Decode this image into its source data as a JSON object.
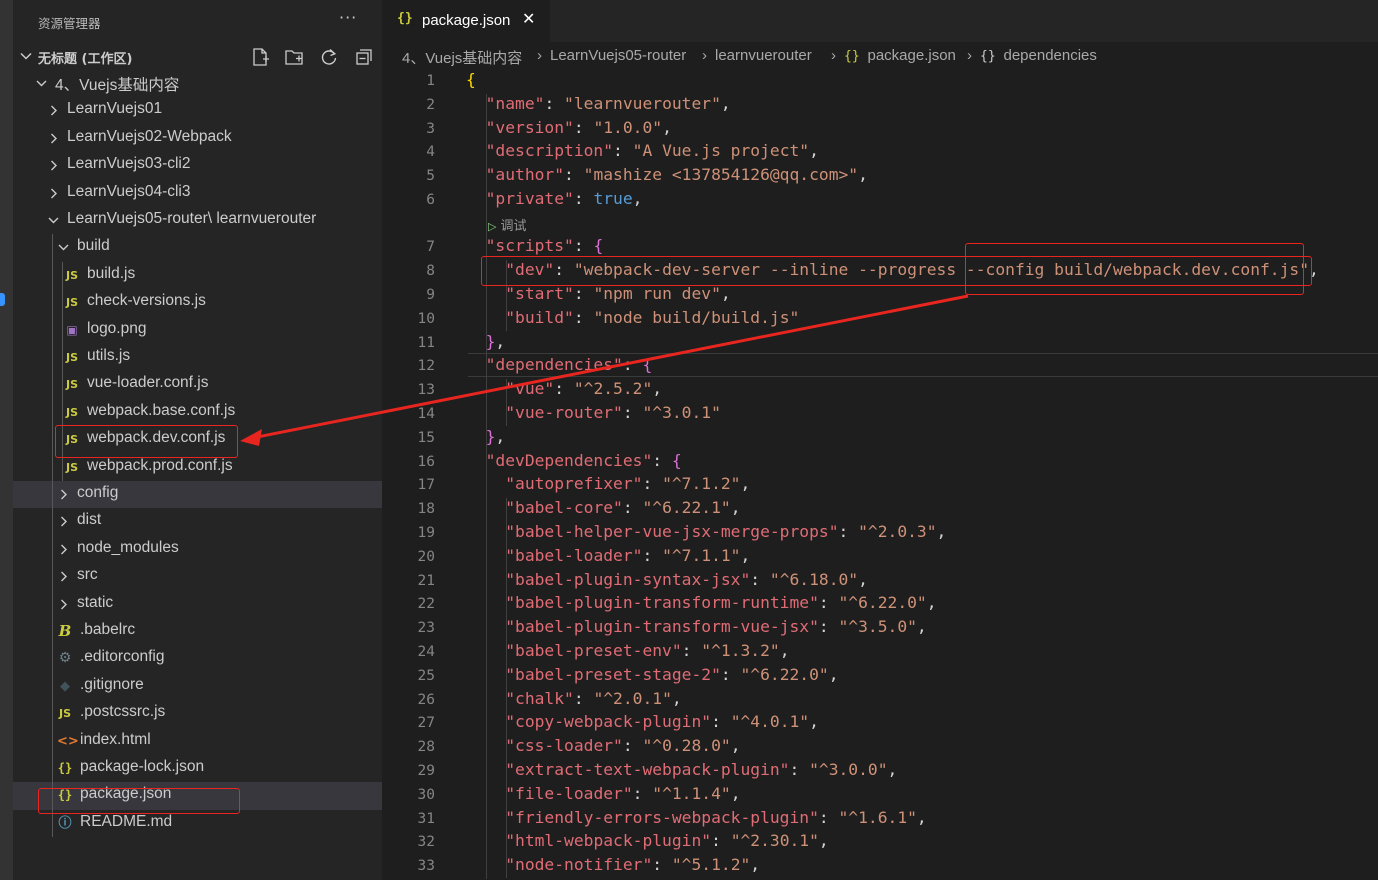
{
  "sidebar": {
    "title": "资源管理器",
    "more": "···",
    "workspace": "无标题 (工作区)",
    "actions": [
      "new-file-icon",
      "new-folder-icon",
      "refresh-icon",
      "collapse-all-icon"
    ],
    "tree": [
      {
        "label": "4、Vuejs基础内容",
        "type": "folder-open",
        "depth": 0
      },
      {
        "label": "LearnVuejs01",
        "type": "folder",
        "depth": 1
      },
      {
        "label": "LearnVuejs02-Webpack",
        "type": "folder",
        "depth": 1
      },
      {
        "label": "LearnVuejs03-cli2",
        "type": "folder",
        "depth": 1
      },
      {
        "label": "LearnVuejs04-cli3",
        "type": "folder",
        "depth": 1
      },
      {
        "label": "LearnVuejs05-router",
        "sub": "\\ learnvuerouter",
        "type": "folder-open",
        "depth": 1
      },
      {
        "label": "build",
        "type": "folder-open",
        "depth": 2
      },
      {
        "label": "build.js",
        "type": "js",
        "depth": 3
      },
      {
        "label": "check-versions.js",
        "type": "js",
        "depth": 3
      },
      {
        "label": "logo.png",
        "type": "png",
        "depth": 3
      },
      {
        "label": "utils.js",
        "type": "js",
        "depth": 3
      },
      {
        "label": "vue-loader.conf.js",
        "type": "js",
        "depth": 3
      },
      {
        "label": "webpack.base.conf.js",
        "type": "js",
        "depth": 3
      },
      {
        "label": "webpack.dev.conf.js",
        "type": "js",
        "depth": 3
      },
      {
        "label": "webpack.prod.conf.js",
        "type": "js",
        "depth": 3
      },
      {
        "label": "config",
        "type": "folder",
        "depth": 2,
        "selected": true
      },
      {
        "label": "dist",
        "type": "folder",
        "depth": 2
      },
      {
        "label": "node_modules",
        "type": "folder",
        "depth": 2
      },
      {
        "label": "src",
        "type": "folder",
        "depth": 2
      },
      {
        "label": "static",
        "type": "folder",
        "depth": 2
      },
      {
        "label": ".babelrc",
        "type": "babel",
        "depth": 2
      },
      {
        "label": ".editorconfig",
        "type": "gear",
        "depth": 2
      },
      {
        "label": ".gitignore",
        "type": "git",
        "depth": 2
      },
      {
        "label": ".postcssrc.js",
        "type": "js",
        "depth": 2
      },
      {
        "label": "index.html",
        "type": "html",
        "depth": 2
      },
      {
        "label": "package-lock.json",
        "type": "json",
        "depth": 2
      },
      {
        "label": "package.json",
        "type": "json",
        "depth": 2,
        "selected": true
      },
      {
        "label": "README.md",
        "type": "info",
        "depth": 2
      }
    ]
  },
  "editor": {
    "tab": {
      "icon": "{}",
      "label": "package.json",
      "close": "✕"
    },
    "breadcrumb": [
      "4、Vuejs基础内容",
      "LearnVuejs05-router",
      "learnvuerouter",
      "package.json",
      "dependencies"
    ],
    "codelens": "调试",
    "lines": [
      {
        "n": "1",
        "tokens": [
          [
            "br1",
            "{"
          ]
        ]
      },
      {
        "n": "2",
        "tokens": [
          [
            "p",
            "  "
          ],
          [
            "key",
            "\"name\""
          ],
          [
            "p",
            ": "
          ],
          [
            "s",
            "\"learnvuerouter\""
          ],
          [
            "p",
            ","
          ]
        ]
      },
      {
        "n": "3",
        "tokens": [
          [
            "p",
            "  "
          ],
          [
            "key",
            "\"version\""
          ],
          [
            "p",
            ": "
          ],
          [
            "s",
            "\"1.0.0\""
          ],
          [
            "p",
            ","
          ]
        ]
      },
      {
        "n": "4",
        "tokens": [
          [
            "p",
            "  "
          ],
          [
            "key",
            "\"description\""
          ],
          [
            "p",
            ": "
          ],
          [
            "s",
            "\"A Vue.js project\""
          ],
          [
            "p",
            ","
          ]
        ]
      },
      {
        "n": "5",
        "tokens": [
          [
            "p",
            "  "
          ],
          [
            "key",
            "\"author\""
          ],
          [
            "p",
            ": "
          ],
          [
            "s",
            "\"mashize <137854126@qq.com>\""
          ],
          [
            "p",
            ","
          ]
        ]
      },
      {
        "n": "6",
        "tokens": [
          [
            "p",
            "  "
          ],
          [
            "key",
            "\"private\""
          ],
          [
            "p",
            ": "
          ],
          [
            "b",
            "true"
          ],
          [
            "p",
            ","
          ]
        ]
      },
      {
        "n": "7",
        "tokens": [
          [
            "p",
            "  "
          ],
          [
            "key",
            "\"scripts\""
          ],
          [
            "p",
            ": "
          ],
          [
            "br2",
            "{"
          ]
        ]
      },
      {
        "n": "8",
        "tokens": [
          [
            "p",
            "    "
          ],
          [
            "key",
            "\"dev\""
          ],
          [
            "p",
            ": "
          ],
          [
            "s",
            "\"webpack-dev-server --inline --progress --config build/webpack.dev.conf.js\""
          ],
          [
            "p",
            ","
          ]
        ]
      },
      {
        "n": "9",
        "tokens": [
          [
            "p",
            "    "
          ],
          [
            "key",
            "\"start\""
          ],
          [
            "p",
            ": "
          ],
          [
            "s",
            "\"npm run dev\""
          ],
          [
            "p",
            ","
          ]
        ]
      },
      {
        "n": "10",
        "tokens": [
          [
            "p",
            "    "
          ],
          [
            "key",
            "\"build\""
          ],
          [
            "p",
            ": "
          ],
          [
            "s",
            "\"node build/build.js\""
          ]
        ]
      },
      {
        "n": "11",
        "tokens": [
          [
            "p",
            "  "
          ],
          [
            "br2",
            "}"
          ],
          [
            "p",
            ","
          ]
        ]
      },
      {
        "n": "12",
        "tokens": [
          [
            "p",
            "  "
          ],
          [
            "key",
            "\"dependencies\""
          ],
          [
            "p",
            ": "
          ],
          [
            "br2",
            "{"
          ]
        ]
      },
      {
        "n": "13",
        "tokens": [
          [
            "p",
            "    "
          ],
          [
            "key",
            "\"vue\""
          ],
          [
            "p",
            ": "
          ],
          [
            "s",
            "\"^2.5.2\""
          ],
          [
            "p",
            ","
          ]
        ]
      },
      {
        "n": "14",
        "tokens": [
          [
            "p",
            "    "
          ],
          [
            "key",
            "\"vue-router\""
          ],
          [
            "p",
            ": "
          ],
          [
            "s",
            "\"^3.0.1\""
          ]
        ]
      },
      {
        "n": "15",
        "tokens": [
          [
            "p",
            "  "
          ],
          [
            "br2",
            "}"
          ],
          [
            "p",
            ","
          ]
        ]
      },
      {
        "n": "16",
        "tokens": [
          [
            "p",
            "  "
          ],
          [
            "key",
            "\"devDependencies\""
          ],
          [
            "p",
            ": "
          ],
          [
            "br2",
            "{"
          ]
        ]
      },
      {
        "n": "17",
        "tokens": [
          [
            "p",
            "    "
          ],
          [
            "key",
            "\"autoprefixer\""
          ],
          [
            "p",
            ": "
          ],
          [
            "s",
            "\"^7.1.2\""
          ],
          [
            "p",
            ","
          ]
        ]
      },
      {
        "n": "18",
        "tokens": [
          [
            "p",
            "    "
          ],
          [
            "key",
            "\"babel-core\""
          ],
          [
            "p",
            ": "
          ],
          [
            "s",
            "\"^6.22.1\""
          ],
          [
            "p",
            ","
          ]
        ]
      },
      {
        "n": "19",
        "tokens": [
          [
            "p",
            "    "
          ],
          [
            "key",
            "\"babel-helper-vue-jsx-merge-props\""
          ],
          [
            "p",
            ": "
          ],
          [
            "s",
            "\"^2.0.3\""
          ],
          [
            "p",
            ","
          ]
        ]
      },
      {
        "n": "20",
        "tokens": [
          [
            "p",
            "    "
          ],
          [
            "key",
            "\"babel-loader\""
          ],
          [
            "p",
            ": "
          ],
          [
            "s",
            "\"^7.1.1\""
          ],
          [
            "p",
            ","
          ]
        ]
      },
      {
        "n": "21",
        "tokens": [
          [
            "p",
            "    "
          ],
          [
            "key",
            "\"babel-plugin-syntax-jsx\""
          ],
          [
            "p",
            ": "
          ],
          [
            "s",
            "\"^6.18.0\""
          ],
          [
            "p",
            ","
          ]
        ]
      },
      {
        "n": "22",
        "tokens": [
          [
            "p",
            "    "
          ],
          [
            "key",
            "\"babel-plugin-transform-runtime\""
          ],
          [
            "p",
            ": "
          ],
          [
            "s",
            "\"^6.22.0\""
          ],
          [
            "p",
            ","
          ]
        ]
      },
      {
        "n": "23",
        "tokens": [
          [
            "p",
            "    "
          ],
          [
            "key",
            "\"babel-plugin-transform-vue-jsx\""
          ],
          [
            "p",
            ": "
          ],
          [
            "s",
            "\"^3.5.0\""
          ],
          [
            "p",
            ","
          ]
        ]
      },
      {
        "n": "24",
        "tokens": [
          [
            "p",
            "    "
          ],
          [
            "key",
            "\"babel-preset-env\""
          ],
          [
            "p",
            ": "
          ],
          [
            "s",
            "\"^1.3.2\""
          ],
          [
            "p",
            ","
          ]
        ]
      },
      {
        "n": "25",
        "tokens": [
          [
            "p",
            "    "
          ],
          [
            "key",
            "\"babel-preset-stage-2\""
          ],
          [
            "p",
            ": "
          ],
          [
            "s",
            "\"^6.22.0\""
          ],
          [
            "p",
            ","
          ]
        ]
      },
      {
        "n": "26",
        "tokens": [
          [
            "p",
            "    "
          ],
          [
            "key",
            "\"chalk\""
          ],
          [
            "p",
            ": "
          ],
          [
            "s",
            "\"^2.0.1\""
          ],
          [
            "p",
            ","
          ]
        ]
      },
      {
        "n": "27",
        "tokens": [
          [
            "p",
            "    "
          ],
          [
            "key",
            "\"copy-webpack-plugin\""
          ],
          [
            "p",
            ": "
          ],
          [
            "s",
            "\"^4.0.1\""
          ],
          [
            "p",
            ","
          ]
        ]
      },
      {
        "n": "28",
        "tokens": [
          [
            "p",
            "    "
          ],
          [
            "key",
            "\"css-loader\""
          ],
          [
            "p",
            ": "
          ],
          [
            "s",
            "\"^0.28.0\""
          ],
          [
            "p",
            ","
          ]
        ]
      },
      {
        "n": "29",
        "tokens": [
          [
            "p",
            "    "
          ],
          [
            "key",
            "\"extract-text-webpack-plugin\""
          ],
          [
            "p",
            ": "
          ],
          [
            "s",
            "\"^3.0.0\""
          ],
          [
            "p",
            ","
          ]
        ]
      },
      {
        "n": "30",
        "tokens": [
          [
            "p",
            "    "
          ],
          [
            "key",
            "\"file-loader\""
          ],
          [
            "p",
            ": "
          ],
          [
            "s",
            "\"^1.1.4\""
          ],
          [
            "p",
            ","
          ]
        ]
      },
      {
        "n": "31",
        "tokens": [
          [
            "p",
            "    "
          ],
          [
            "key",
            "\"friendly-errors-webpack-plugin\""
          ],
          [
            "p",
            ": "
          ],
          [
            "s",
            "\"^1.6.1\""
          ],
          [
            "p",
            ","
          ]
        ]
      },
      {
        "n": "32",
        "tokens": [
          [
            "p",
            "    "
          ],
          [
            "key",
            "\"html-webpack-plugin\""
          ],
          [
            "p",
            ": "
          ],
          [
            "s",
            "\"^2.30.1\""
          ],
          [
            "p",
            ","
          ]
        ]
      },
      {
        "n": "33",
        "tokens": [
          [
            "p",
            "    "
          ],
          [
            "key",
            "\"node-notifier\""
          ],
          [
            "p",
            ": "
          ],
          [
            "s",
            "\"^5.1.2\""
          ],
          [
            "p",
            ","
          ]
        ]
      }
    ]
  },
  "colors": {
    "annotation": "#e8261f",
    "accent": "#3794ff",
    "json_key": "#e06c75",
    "json_string": "#ce9178",
    "json_boolean": "#569cd6"
  }
}
